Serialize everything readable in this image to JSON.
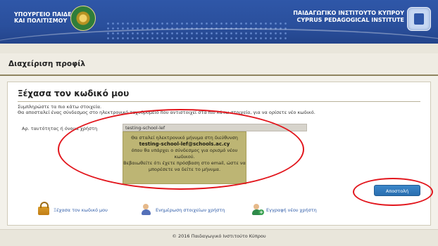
{
  "header": {
    "ministry_line1": "ΥΠΟΥΡΓΕΙΟ ΠΑΙΔΕΙΑΣ",
    "ministry_line2": "ΚΑΙ ΠΟΛΙΤΙΣΜΟΥ",
    "institute_line1": "ΠΑΙΔΑΓΩΓΙΚΟ ΙΝΣΤΙΤΟΥΤΟ ΚΥΠΡΟΥ",
    "institute_line2": "CYPRUS PEDAGOGICAL INSTITUTE"
  },
  "page": {
    "title": "Διαχείριση προφίλ"
  },
  "form": {
    "heading": "Ξέχασα τον κωδικό μου",
    "desc_line1": "Συμπληρώστε τα πιο κάτω στοιχεία.",
    "desc_line2": "Θα αποσταλεί ένας σύνδεσμος στο ηλεκτρονικό ταχυδρομείο που αντιστοιχεί στα πιο κάτω στοιχεία, για να ορίσετε νέο κωδικό.",
    "field_label": "Αρ. ταυτότητας ή όνομα χρήστη",
    "field_value": "testing-school-lef",
    "message_line1": "Θα σταλεί ηλεκτρονικό μήνυμα στη διεύθυνση",
    "message_email": "testing-school-lef@schools.ac.cy",
    "message_line2": "όπου θα υπάρχει ο σύνδεσμος για ορισμό νέου",
    "message_line3": "κωδικού.",
    "message_line4": "Βεβαιωθείτε ότι έχετε πρόσβαση στο email, ώστε να",
    "message_line5": "μπορέσετε να δείτε το μήνυμα.",
    "submit_label": "Αποστολή"
  },
  "links": {
    "forgot": "Ξέχασα τον κωδικό μου",
    "update": "Ενημέρωση στοιχείων χρήστη",
    "register": "Εγγραφή νέου χρήστη"
  },
  "footer": {
    "text": "© 2016 Παιδαγωγικό Ινστιτούτο Κύπρου"
  },
  "colors": {
    "banner": "#2f57a8",
    "annotation": "#e2151c",
    "message_bg": "#bdb574",
    "button": "#2a6fb0"
  },
  "icons": [
    "cyprus-emblem-icon",
    "institute-logo-icon",
    "lock-icon",
    "user-edit-icon",
    "user-add-icon"
  ]
}
